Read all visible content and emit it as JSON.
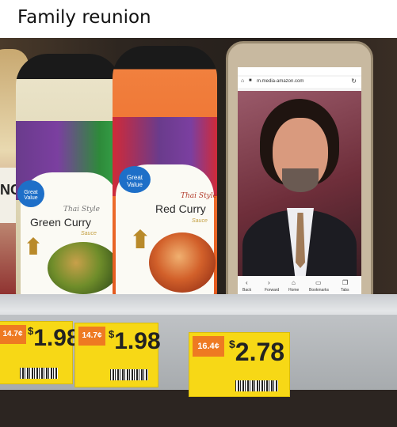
{
  "caption": "Family reunion",
  "bottles": {
    "left_partial": {
      "label": "NG"
    },
    "green": {
      "brand": "Great Value",
      "style": "Thai Style",
      "name": "Green Curry",
      "sub": "Sauce"
    },
    "red": {
      "brand": "Great Value",
      "style": "Thai Style",
      "name": "Red Curry",
      "sub": "Sauce"
    }
  },
  "phone": {
    "url": "m.media-amazon.com",
    "nav": [
      "Back",
      "Forward",
      "Home",
      "Bookmarks",
      "Tabs"
    ]
  },
  "tags": [
    {
      "unit": "14.7¢",
      "price": "1.98"
    },
    {
      "unit": "14.7¢",
      "price": "1.98"
    },
    {
      "unit": "16.4¢",
      "price": "2.78"
    }
  ],
  "colors": {
    "tag_yellow": "#f7d816",
    "unit_orange": "#ee7a22",
    "great_value_blue": "#1e6fc8",
    "green_curry_bottle": "#e9e2c6",
    "red_curry_bottle": "#ef7a3a"
  }
}
